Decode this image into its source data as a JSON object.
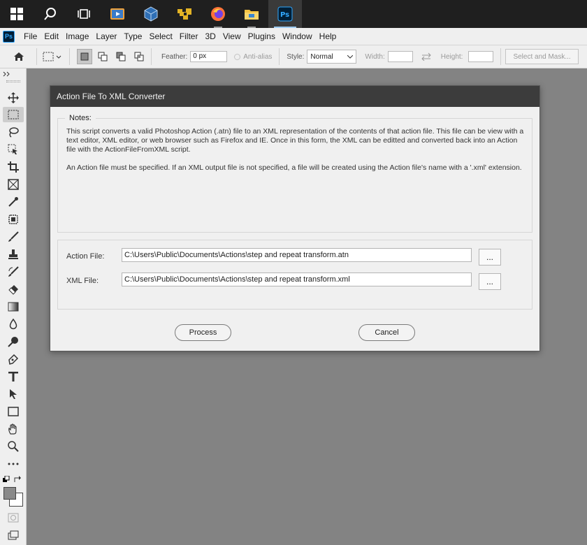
{
  "menubar": {
    "logo": "Ps",
    "items": [
      "File",
      "Edit",
      "Image",
      "Layer",
      "Type",
      "Select",
      "Filter",
      "3D",
      "View",
      "Plugins",
      "Window",
      "Help"
    ]
  },
  "options": {
    "feather_label": "Feather:",
    "feather_value": "0 px",
    "antialias_label": "Anti-alias",
    "style_label": "Style:",
    "style_value": "Normal",
    "width_label": "Width:",
    "height_label": "Height:",
    "select_mask_label": "Select and Mask..."
  },
  "dialog": {
    "title": "Action File To XML Converter",
    "notes_legend": "Notes:",
    "notes_p1": "This script converts a valid Photoshop Action (.atn) file to an XML representation of the contents of that action file. This file can be view with a text editor, XML editor, or web browser such as Firefox and IE. Once in this form, the XML can be editted and converted back into an Action file with the ActionFileFromXML script.",
    "notes_p2": "An Action file must be specified. If an XML output file is not specified, a file will be created using the Action file's name with a '.xml' extension.",
    "action_file_label": "Action File:",
    "action_file_value": "C:\\Users\\Public\\Documents\\Actions\\step and repeat transform.atn",
    "xml_file_label": "XML File:",
    "xml_file_value": "C:\\Users\\Public\\Documents\\Actions\\step and repeat transform.xml",
    "browse_label": "...",
    "process_label": "Process",
    "cancel_label": "Cancel"
  },
  "colors": {
    "taskbar": "#1f1f1f",
    "dialog_title": "#3c3c3c",
    "canvas": "#838383",
    "ps_accent": "#31a8ff"
  }
}
